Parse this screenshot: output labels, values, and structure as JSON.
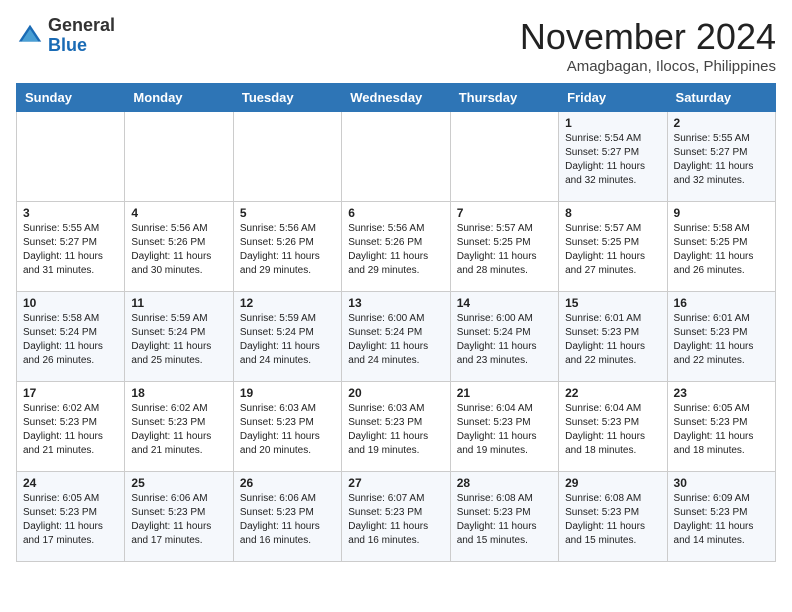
{
  "logo": {
    "general": "General",
    "blue": "Blue"
  },
  "header": {
    "month": "November 2024",
    "location": "Amagbagan, Ilocos, Philippines"
  },
  "days_of_week": [
    "Sunday",
    "Monday",
    "Tuesday",
    "Wednesday",
    "Thursday",
    "Friday",
    "Saturday"
  ],
  "weeks": [
    [
      {
        "day": "",
        "info": ""
      },
      {
        "day": "",
        "info": ""
      },
      {
        "day": "",
        "info": ""
      },
      {
        "day": "",
        "info": ""
      },
      {
        "day": "",
        "info": ""
      },
      {
        "day": "1",
        "info": "Sunrise: 5:54 AM\nSunset: 5:27 PM\nDaylight: 11 hours and 32 minutes."
      },
      {
        "day": "2",
        "info": "Sunrise: 5:55 AM\nSunset: 5:27 PM\nDaylight: 11 hours and 32 minutes."
      }
    ],
    [
      {
        "day": "3",
        "info": "Sunrise: 5:55 AM\nSunset: 5:27 PM\nDaylight: 11 hours and 31 minutes."
      },
      {
        "day": "4",
        "info": "Sunrise: 5:56 AM\nSunset: 5:26 PM\nDaylight: 11 hours and 30 minutes."
      },
      {
        "day": "5",
        "info": "Sunrise: 5:56 AM\nSunset: 5:26 PM\nDaylight: 11 hours and 29 minutes."
      },
      {
        "day": "6",
        "info": "Sunrise: 5:56 AM\nSunset: 5:26 PM\nDaylight: 11 hours and 29 minutes."
      },
      {
        "day": "7",
        "info": "Sunrise: 5:57 AM\nSunset: 5:25 PM\nDaylight: 11 hours and 28 minutes."
      },
      {
        "day": "8",
        "info": "Sunrise: 5:57 AM\nSunset: 5:25 PM\nDaylight: 11 hours and 27 minutes."
      },
      {
        "day": "9",
        "info": "Sunrise: 5:58 AM\nSunset: 5:25 PM\nDaylight: 11 hours and 26 minutes."
      }
    ],
    [
      {
        "day": "10",
        "info": "Sunrise: 5:58 AM\nSunset: 5:24 PM\nDaylight: 11 hours and 26 minutes."
      },
      {
        "day": "11",
        "info": "Sunrise: 5:59 AM\nSunset: 5:24 PM\nDaylight: 11 hours and 25 minutes."
      },
      {
        "day": "12",
        "info": "Sunrise: 5:59 AM\nSunset: 5:24 PM\nDaylight: 11 hours and 24 minutes."
      },
      {
        "day": "13",
        "info": "Sunrise: 6:00 AM\nSunset: 5:24 PM\nDaylight: 11 hours and 24 minutes."
      },
      {
        "day": "14",
        "info": "Sunrise: 6:00 AM\nSunset: 5:24 PM\nDaylight: 11 hours and 23 minutes."
      },
      {
        "day": "15",
        "info": "Sunrise: 6:01 AM\nSunset: 5:23 PM\nDaylight: 11 hours and 22 minutes."
      },
      {
        "day": "16",
        "info": "Sunrise: 6:01 AM\nSunset: 5:23 PM\nDaylight: 11 hours and 22 minutes."
      }
    ],
    [
      {
        "day": "17",
        "info": "Sunrise: 6:02 AM\nSunset: 5:23 PM\nDaylight: 11 hours and 21 minutes."
      },
      {
        "day": "18",
        "info": "Sunrise: 6:02 AM\nSunset: 5:23 PM\nDaylight: 11 hours and 21 minutes."
      },
      {
        "day": "19",
        "info": "Sunrise: 6:03 AM\nSunset: 5:23 PM\nDaylight: 11 hours and 20 minutes."
      },
      {
        "day": "20",
        "info": "Sunrise: 6:03 AM\nSunset: 5:23 PM\nDaylight: 11 hours and 19 minutes."
      },
      {
        "day": "21",
        "info": "Sunrise: 6:04 AM\nSunset: 5:23 PM\nDaylight: 11 hours and 19 minutes."
      },
      {
        "day": "22",
        "info": "Sunrise: 6:04 AM\nSunset: 5:23 PM\nDaylight: 11 hours and 18 minutes."
      },
      {
        "day": "23",
        "info": "Sunrise: 6:05 AM\nSunset: 5:23 PM\nDaylight: 11 hours and 18 minutes."
      }
    ],
    [
      {
        "day": "24",
        "info": "Sunrise: 6:05 AM\nSunset: 5:23 PM\nDaylight: 11 hours and 17 minutes."
      },
      {
        "day": "25",
        "info": "Sunrise: 6:06 AM\nSunset: 5:23 PM\nDaylight: 11 hours and 17 minutes."
      },
      {
        "day": "26",
        "info": "Sunrise: 6:06 AM\nSunset: 5:23 PM\nDaylight: 11 hours and 16 minutes."
      },
      {
        "day": "27",
        "info": "Sunrise: 6:07 AM\nSunset: 5:23 PM\nDaylight: 11 hours and 16 minutes."
      },
      {
        "day": "28",
        "info": "Sunrise: 6:08 AM\nSunset: 5:23 PM\nDaylight: 11 hours and 15 minutes."
      },
      {
        "day": "29",
        "info": "Sunrise: 6:08 AM\nSunset: 5:23 PM\nDaylight: 11 hours and 15 minutes."
      },
      {
        "day": "30",
        "info": "Sunrise: 6:09 AM\nSunset: 5:23 PM\nDaylight: 11 hours and 14 minutes."
      }
    ]
  ]
}
